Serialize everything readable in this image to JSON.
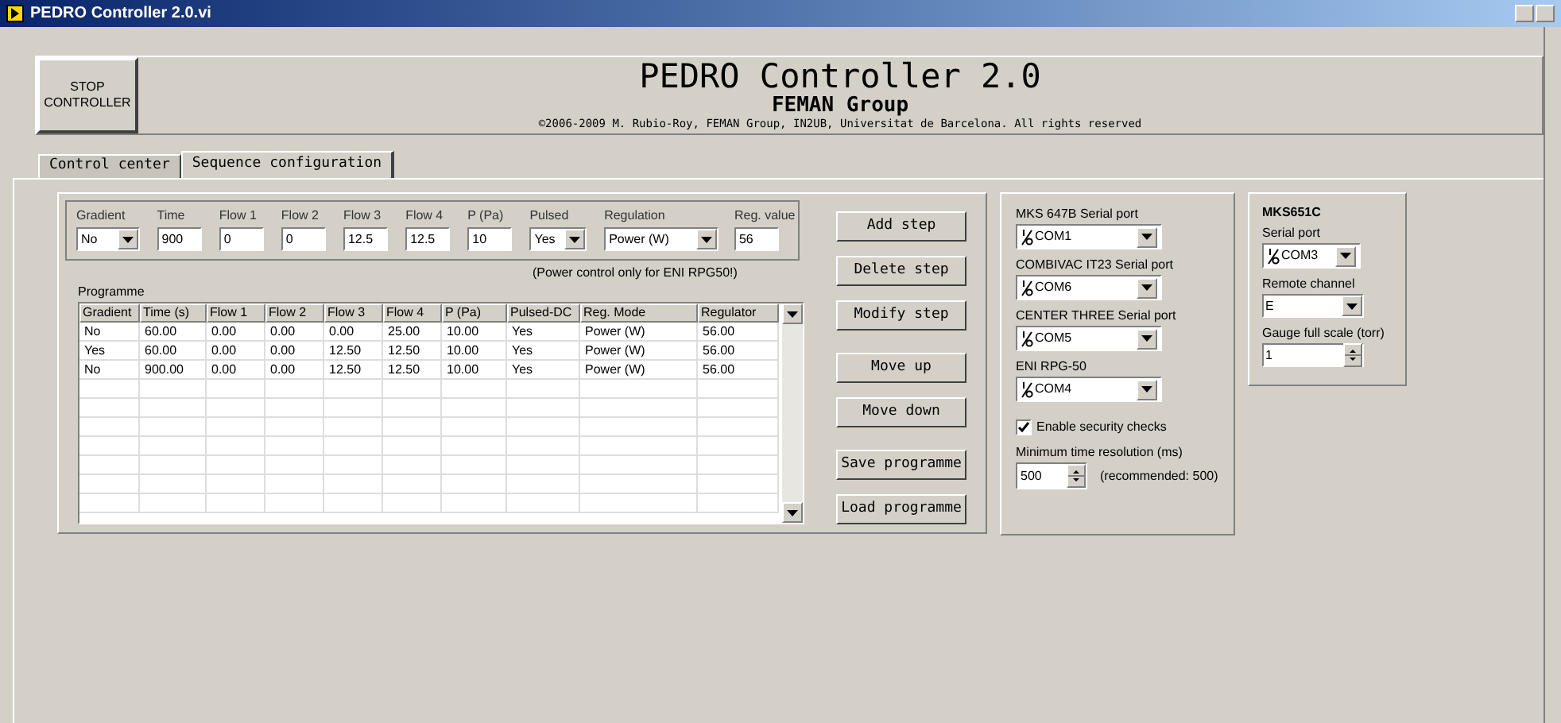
{
  "window": {
    "title": "PEDRO Controller 2.0.vi"
  },
  "header": {
    "stop_button": "STOP\nCONTROLLER",
    "title": "PEDRO Controller 2.0",
    "subtitle": "FEMAN Group",
    "copyright": "©2006-2009 M. Rubio-Roy, FEMAN Group, IN2UB, Universitat de Barcelona. All rights reserved"
  },
  "tabs": [
    {
      "label": "Control center",
      "selected": false
    },
    {
      "label": "Sequence configuration",
      "selected": true
    }
  ],
  "step_editor": {
    "fields": [
      {
        "label": "Gradient",
        "value": "No",
        "kind": "dropdown"
      },
      {
        "label": "Time",
        "value": "900",
        "kind": "text"
      },
      {
        "label": "Flow 1",
        "value": "0",
        "kind": "text"
      },
      {
        "label": "Flow 2",
        "value": "0",
        "kind": "text"
      },
      {
        "label": "Flow 3",
        "value": "12.5",
        "kind": "text"
      },
      {
        "label": "Flow 4",
        "value": "12.5",
        "kind": "text"
      },
      {
        "label": "P (Pa)",
        "value": "10",
        "kind": "text"
      },
      {
        "label": "Pulsed",
        "value": "Yes",
        "kind": "dropdown"
      },
      {
        "label": "Regulation",
        "value": "Power (W)",
        "kind": "dropdown"
      },
      {
        "label": "Reg. value",
        "value": "56",
        "kind": "text"
      }
    ],
    "note": "(Power control only for ENI RPG50!)"
  },
  "programme": {
    "label": "Programme",
    "columns": [
      "Gradient",
      "Time (s)",
      "Flow 1",
      "Flow 2",
      "Flow 3",
      "Flow 4",
      "P (Pa)",
      "Pulsed-DC",
      "Reg. Mode",
      "Regulator"
    ],
    "rows": [
      [
        "No",
        "60.00",
        "0.00",
        "0.00",
        "0.00",
        "25.00",
        "10.00",
        "Yes",
        "Power (W)",
        "56.00"
      ],
      [
        "Yes",
        "60.00",
        "0.00",
        "0.00",
        "12.50",
        "12.50",
        "10.00",
        "Yes",
        "Power (W)",
        "56.00"
      ],
      [
        "No",
        "900.00",
        "0.00",
        "0.00",
        "12.50",
        "12.50",
        "10.00",
        "Yes",
        "Power (W)",
        "56.00"
      ]
    ]
  },
  "buttons": [
    "Add step",
    "Delete step",
    "Modify step",
    "Move up",
    "Move down",
    "Save programme",
    "Load programme"
  ],
  "serial_ports": [
    {
      "label": "MKS 647B Serial port",
      "value": "COM1"
    },
    {
      "label": "COMBIVAC IT23 Serial port",
      "value": "COM6"
    },
    {
      "label": "CENTER THREE Serial port",
      "value": "COM5"
    },
    {
      "label": "ENI RPG-50",
      "value": "COM4"
    }
  ],
  "security_checks": {
    "label": "Enable security checks",
    "checked": true
  },
  "min_time": {
    "label": "Minimum time resolution (ms)",
    "value": "500",
    "note": "(recommended: 500)"
  },
  "mks651c": {
    "title": "MKS651C",
    "serial_port": {
      "label": "Serial port",
      "value": "COM3"
    },
    "remote_channel": {
      "label": "Remote channel",
      "value": "E"
    },
    "gauge": {
      "label": "Gauge full scale (torr)",
      "value": "1"
    }
  }
}
